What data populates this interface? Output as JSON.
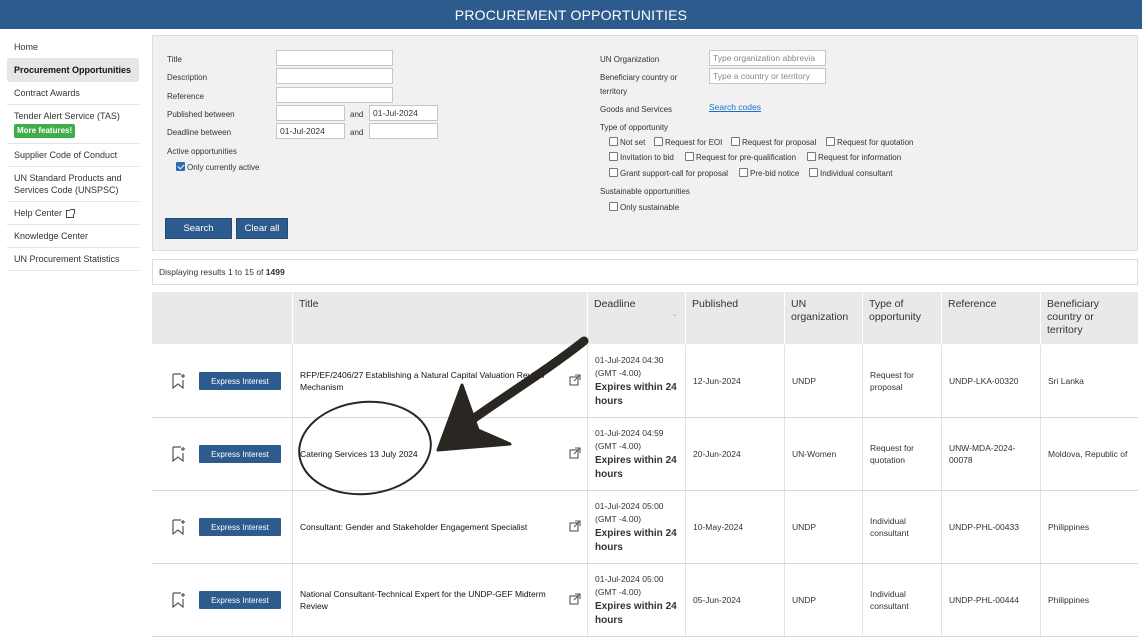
{
  "header": {
    "title": "PROCUREMENT OPPORTUNITIES"
  },
  "sidebar": {
    "items": [
      {
        "label": "Home"
      },
      {
        "label": "Procurement Opportunities"
      },
      {
        "label": "Contract Awards"
      },
      {
        "label": "Tender Alert Service (TAS)",
        "badge": "More features!"
      },
      {
        "label": "Supplier Code of Conduct"
      },
      {
        "label": "UN Standard Products and Services Code (UNSPSC)"
      },
      {
        "label": "Help Center"
      },
      {
        "label": "Knowledge Center"
      },
      {
        "label": "UN Procurement Statistics"
      }
    ]
  },
  "filters": {
    "title_label": "Title",
    "description_label": "Description",
    "reference_label": "Reference",
    "published_label": "Published between",
    "published_and": "and",
    "published_to": "01-Jul-2024",
    "deadline_label": "Deadline between",
    "deadline_from": "01-Jul-2024",
    "deadline_and": "and",
    "active_label": "Active opportunities",
    "only_active_label": "Only currently active",
    "un_org_label": "UN Organization",
    "un_org_placeholder": "Type organization abbrevia",
    "beneficiary_label_1": "Beneficiary country or",
    "beneficiary_label_2": "territory",
    "beneficiary_placeholder": "Type a country or territory",
    "goods_label": "Goods and Services",
    "search_codes": "Search codes",
    "type_label": "Type of opportunity",
    "types": {
      "not_set": "Not set",
      "eoi": "Request for EOI",
      "proposal": "Request for proposal",
      "quotation": "Request for quotation",
      "invitation": "Invitation to bid",
      "prequal": "Request for pre-qualification",
      "info": "Request for information",
      "grant": "Grant support-call for proposal",
      "prebid": "Pre-bid notice",
      "consultant": "Individual consultant"
    },
    "sustainable_label": "Sustainable opportunities",
    "only_sustainable": "Only sustainable",
    "search_button": "Search",
    "clear_button": "Clear all"
  },
  "results": {
    "prefix": "Displaying results 1 to 15 of",
    "total": "1499"
  },
  "table": {
    "headers": [
      "Title",
      "Deadline",
      "Published",
      "UN organization",
      "Type of opportunity",
      "Reference",
      "Beneficiary country or territory"
    ],
    "express_label": "Express Interest",
    "rows": [
      {
        "title": "RFP/EF/2406/27 Establishing a Natural Capital Valuation Review Mechanism",
        "deadline": "01-Jul-2024 04:30",
        "tz": "(GMT -4.00)",
        "expires": "Expires within 24 hours",
        "published": "12-Jun-2024",
        "org": "UNDP",
        "type": "Request for proposal",
        "reference": "UNDP-LKA-00320",
        "country": "Sri Lanka"
      },
      {
        "title": "Catering Services 13 July 2024",
        "deadline": "01-Jul-2024 04:59",
        "tz": "(GMT -4.00)",
        "expires": "Expires within 24 hours",
        "published": "20-Jun-2024",
        "org": "UN-Women",
        "type": "Request for quotation",
        "reference": "UNW-MDA-2024-00078",
        "country": "Moldova, Republic of"
      },
      {
        "title": "Consultant: Gender and Stakeholder Engagement Specialist",
        "deadline": "01-Jul-2024 05:00",
        "tz": "(GMT -4.00)",
        "expires": "Expires within 24 hours",
        "published": "10-May-2024",
        "org": "UNDP",
        "type": "Individual consultant",
        "reference": "UNDP-PHL-00433",
        "country": "Philippines"
      },
      {
        "title": "National Consultant-Technical Expert for the UNDP-GEF Midterm Review",
        "deadline": "01-Jul-2024 05:00",
        "tz": "(GMT -4.00)",
        "expires": "Expires within 24 hours",
        "published": "05-Jun-2024",
        "org": "UNDP",
        "type": "Individual consultant",
        "reference": "UNDP-PHL-00444",
        "country": "Philippines"
      }
    ]
  },
  "colors": {
    "brand": "#2d5b8e",
    "badge": "#3fae49",
    "link": "#1a6fc9"
  }
}
